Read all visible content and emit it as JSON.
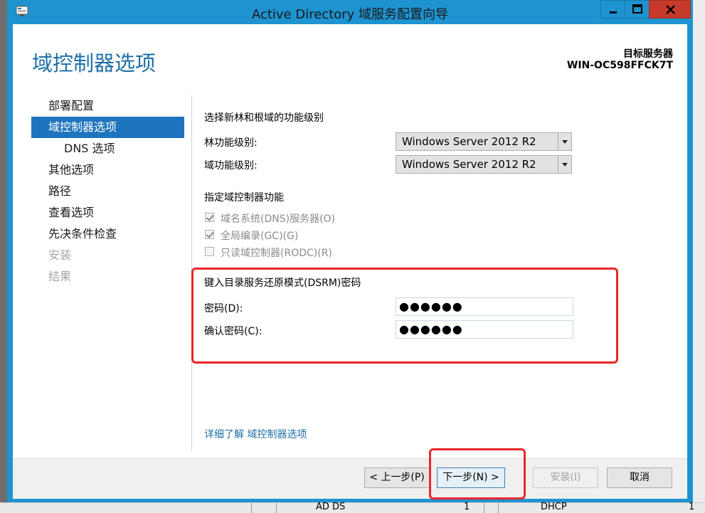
{
  "window": {
    "title": "Active Directory 域服务配置向导",
    "controls": {
      "minimize": "minimize-icon",
      "maximize": "maximize-icon",
      "close": "close-icon"
    }
  },
  "header": {
    "page_title": "域控制器选项",
    "target_server_label": "目标服务器",
    "target_server_name": "WIN-OC598FFCK7T"
  },
  "nav": {
    "items": [
      {
        "label": "部署配置",
        "state": "normal"
      },
      {
        "label": "域控制器选项",
        "state": "active"
      },
      {
        "label": "DNS 选项",
        "state": "sub"
      },
      {
        "label": "其他选项",
        "state": "normal"
      },
      {
        "label": "路径",
        "state": "normal"
      },
      {
        "label": "查看选项",
        "state": "normal"
      },
      {
        "label": "先决条件检查",
        "state": "normal"
      },
      {
        "label": "安装",
        "state": "disabled"
      },
      {
        "label": "结果",
        "state": "disabled"
      }
    ]
  },
  "functional_level": {
    "section_title": "选择新林和根域的功能级别",
    "forest_label": "林功能级别:",
    "forest_value": "Windows Server 2012 R2",
    "domain_label": "域功能级别:",
    "domain_value": "Windows Server 2012 R2"
  },
  "dc_capabilities": {
    "section_title": "指定域控制器功能",
    "dns_label": "域名系统(DNS)服务器(O)",
    "dns_checked": true,
    "gc_label": "全局编录(GC)(G)",
    "gc_checked": true,
    "rodc_label": "只读域控制器(RODC)(R)",
    "rodc_checked": false
  },
  "dsrm": {
    "section_title": "键入目录服务还原模式(DSRM)密码",
    "password_label": "密码(D):",
    "password_value": "●●●●●●",
    "confirm_label": "确认密码(C):",
    "confirm_value": "●●●●●●"
  },
  "link_text": "详细了解 域控制器选项",
  "buttons": {
    "prev": "< 上一步(P)",
    "next": "下一步(N) >",
    "install": "安装(I)",
    "cancel": "取消"
  },
  "background": {
    "taskbar_item_1": "AD DS",
    "taskbar_count_1": "1",
    "taskbar_item_2": "DHCP",
    "taskbar_count_2": "1"
  },
  "colors": {
    "title_bar": "#1e93d0",
    "nav_active": "#1e74bd",
    "heading": "#1e6fa6",
    "annotation_red": "#e8282a"
  }
}
